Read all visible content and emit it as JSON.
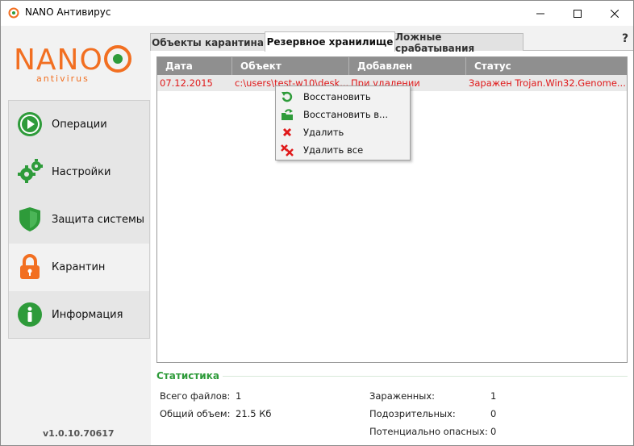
{
  "window": {
    "title": "NANO Антивирус",
    "buttons": {
      "minimize": "—",
      "maximize": "☐",
      "close": "✕"
    }
  },
  "logo": {
    "text_main": "NANO",
    "text_sub": "antivirus"
  },
  "sidebar": {
    "items": [
      {
        "label": "Операции",
        "icon": "play-icon",
        "active": false
      },
      {
        "label": "Настройки",
        "icon": "gears-icon",
        "active": false
      },
      {
        "label": "Защита системы",
        "icon": "shield-icon",
        "active": false
      },
      {
        "label": "Карантин",
        "icon": "lock-icon",
        "active": true
      },
      {
        "label": "Информация",
        "icon": "info-icon",
        "active": false
      }
    ],
    "version": "v1.0.10.70617"
  },
  "tabs": [
    {
      "label": "Объекты карантина",
      "active": false
    },
    {
      "label": "Резервное хранилище",
      "active": true
    },
    {
      "label": "Ложные срабатывания",
      "active": false
    }
  ],
  "help": "?",
  "table": {
    "columns": [
      "Дата",
      "Объект",
      "Добавлен",
      "Статус"
    ],
    "rows": [
      {
        "date": "07.12.2015",
        "object": "c:\\users\\test-w10\\desk...",
        "added": "При удалении",
        "status": "Заражен Trojan.Win32.Genome...."
      }
    ]
  },
  "context_menu": {
    "items": [
      {
        "label": "Восстановить",
        "icon": "restore-icon"
      },
      {
        "label": "Восстановить в...",
        "icon": "restore-to-icon"
      },
      {
        "label": "Удалить",
        "icon": "delete-icon"
      },
      {
        "label": "Удалить все",
        "icon": "delete-all-icon"
      }
    ]
  },
  "statistics": {
    "title": "Статистика",
    "total_files_label": "Всего файлов:",
    "total_files": "1",
    "total_size_label": "Общий объем:",
    "total_size": "21.5 Кб",
    "infected_label": "Зараженных:",
    "infected": "1",
    "suspicious_label": "Подозрительных:",
    "suspicious": "0",
    "potentially_dangerous_label": "Потенциально опасных:",
    "potentially_dangerous": "0"
  },
  "colors": {
    "brand_green": "#2e9b3a",
    "brand_orange": "#f26f21",
    "infected_red": "#e0191a",
    "header_gray": "#8f8f8f"
  }
}
